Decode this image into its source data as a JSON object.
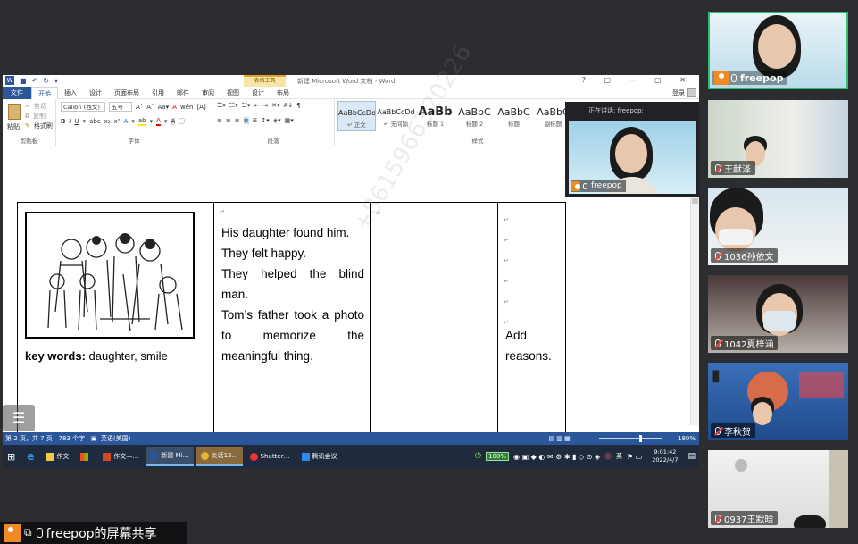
{
  "word": {
    "contextual_tab": "表格工具",
    "title": "新建 Microsoft Word 文档 - Word",
    "login": "登录",
    "tabs": [
      "文件",
      "开始",
      "插入",
      "设计",
      "页面布局",
      "引用",
      "邮件",
      "审阅",
      "视图",
      "设计",
      "布局"
    ],
    "clipboard": {
      "paste": "粘贴",
      "cut": "剪切",
      "copy": "复制",
      "format_painter": "格式刷",
      "label": "剪贴板"
    },
    "font": {
      "name": "Calibri (西文)",
      "size": "五号",
      "label": "字体"
    },
    "paragraph_label": "段落",
    "styles_label": "样式",
    "styles": [
      {
        "preview": "AaBbCcDd",
        "name": "↵ 正文"
      },
      {
        "preview": "AaBbCcDd",
        "name": "↵ 无间隔"
      },
      {
        "preview": "AaBb",
        "name": "标题 1"
      },
      {
        "preview": "AaBbC",
        "name": "标题 2"
      },
      {
        "preview": "AaBbC",
        "name": "标题"
      },
      {
        "preview": "AaBbC",
        "name": "副标题"
      }
    ],
    "cell1_keywords_label": "key words:",
    "cell1_keywords": " daughter, smile",
    "cell2_lines": [
      "His daughter found him.",
      "They felt happy.",
      "They helped the blind man.",
      "Tom’s father took a photo to memorize the meaningful thing."
    ],
    "cell4_text": "Add reasons.",
    "status": {
      "page": "第 2 页，共 7 页",
      "words": "783 个字",
      "lang": "英语(美国)",
      "zoom": "180%"
    }
  },
  "taskbar": {
    "items": [
      "作文",
      "作文—…",
      "新建 Mi…",
      "炎话12…",
      "Shutter…",
      "腾讯会议"
    ],
    "battery": "100%",
    "ime": "英",
    "time": "9:01:42",
    "date": "2022/4/7"
  },
  "presenter": {
    "speaking_label": "正在讲话: freepop;",
    "name": "freepop"
  },
  "participants": [
    {
      "name": "freepop",
      "active": true
    },
    {
      "name": "王献泽",
      "active": false
    },
    {
      "name": "1036孙依文",
      "active": false
    },
    {
      "name": "1042夏梓涵",
      "active": false
    },
    {
      "name": "李秋贺",
      "active": false
    },
    {
      "name": "0937王默晗",
      "active": false
    }
  ],
  "share_label": "freepop的屏幕共享",
  "watermark": "+8615966320226",
  "colors": {
    "word_blue": "#2b579a",
    "active_border": "#2fbf71",
    "user_orange": "#f08a24"
  }
}
